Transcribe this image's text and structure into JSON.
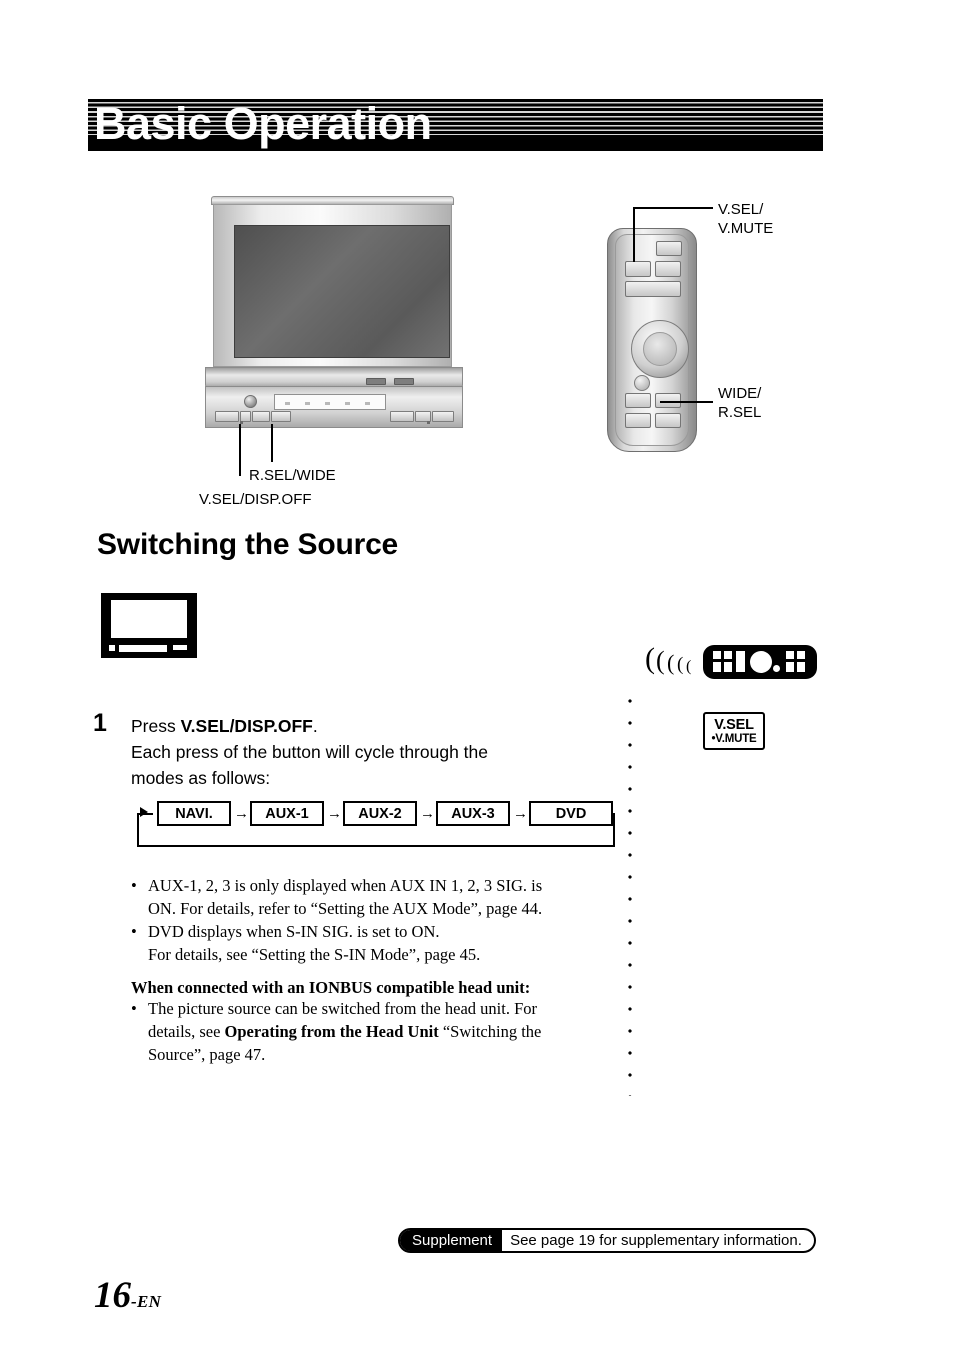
{
  "header": {
    "title": "Basic Operation"
  },
  "diagram_top": {
    "monitor_callouts": [
      {
        "label": "R.SEL/WIDE"
      },
      {
        "label": "V.SEL/DISP.OFF"
      }
    ],
    "remote_callouts": [
      {
        "label": "V.SEL/\nV.MUTE",
        "line1": "V.SEL/",
        "line2": "V.MUTE"
      },
      {
        "label": "WIDE/\nR.SEL",
        "line1": "WIDE/",
        "line2": "R.SEL"
      }
    ]
  },
  "section": {
    "heading": "Switching the Source"
  },
  "step": {
    "number": "1",
    "line1_prefix": "Press ",
    "line1_bold": "V.SEL/DISP.OFF",
    "line1_suffix": ".",
    "line2": "Each press of the button will cycle through the",
    "line3": "modes as follows:"
  },
  "flow": {
    "type": "cycle",
    "items": [
      "NAVI.",
      "AUX-1",
      "AUX-2",
      "AUX-3",
      "DVD"
    ],
    "arrow": "→"
  },
  "notes": [
    {
      "bullet": "•",
      "line1": "AUX-1, 2, 3 is only displayed when AUX IN 1, 2, 3 SIG. is",
      "line2": "ON. For details, refer to “Setting the AUX Mode”, page 44."
    },
    {
      "bullet": "•",
      "line1": "DVD displays when S-IN SIG. is set to ON.",
      "line2": "For details, see “Setting the S-IN Mode”, page 45."
    }
  ],
  "ionbus": {
    "heading": "When connected with an IONBUS compatible head unit:",
    "bullet": "•",
    "line1_a": "The picture source can be switched from the head unit. For",
    "line2_a": "details, see ",
    "line2_bold": "Operating from the Head Unit",
    "line2_b": " “Switching the",
    "line3": "Source”, page 47."
  },
  "keybox": {
    "line1": "V.SEL",
    "line2": "•V.MUTE"
  },
  "ir": {
    "waves": "((((("
  },
  "footer": {
    "supplement_tag": "Supplement",
    "supplement_text": "See page 19 for supplementary information."
  },
  "page": {
    "number": "16",
    "suffix": "-EN"
  },
  "colors": {
    "ink": "#000000",
    "paper": "#ffffff",
    "banner": "#000000",
    "banner_stripe": "#d6d6d6"
  }
}
